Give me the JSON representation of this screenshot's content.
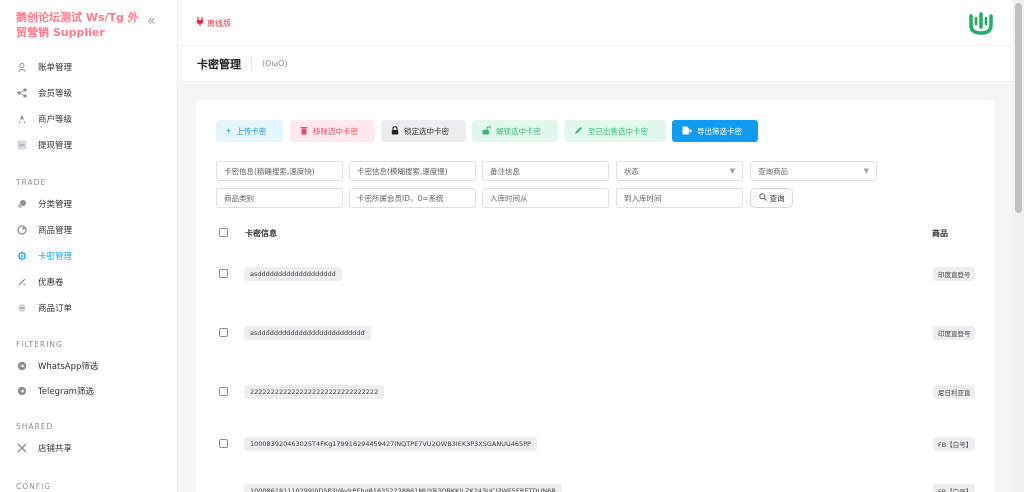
{
  "brand": {
    "name": "鹅创论坛测试 Ws/Tg 外贸营销 Supplier",
    "collapse_icon": "double-chevron-left-icon"
  },
  "sidebar": {
    "top_items": [
      {
        "label": "账单管理",
        "icon": "user-bill-icon"
      },
      {
        "label": "会员等级",
        "icon": "share-nodes-icon"
      },
      {
        "label": "商户等级",
        "icon": "rocket-icon"
      },
      {
        "label": "提现管理",
        "icon": "minus-box-icon"
      }
    ],
    "trade_title": "TRADE",
    "trade_items": [
      {
        "label": "分类管理",
        "icon": "category-icon"
      },
      {
        "label": "商品管理",
        "icon": "goods-icon"
      },
      {
        "label": "卡密管理",
        "icon": "gear-icon",
        "active": true
      },
      {
        "label": "优惠卷",
        "icon": "coupon-icon"
      },
      {
        "label": "商品订单",
        "icon": "order-icon"
      }
    ],
    "filtering_title": "FILTERING",
    "filtering_items": [
      {
        "label": "WhatsApp筛选",
        "icon": "arrow-circle-icon"
      },
      {
        "label": "Telegram筛选",
        "icon": "arrow-circle-icon"
      }
    ],
    "shared_title": "SHARED",
    "shared_items": [
      {
        "label": "店铺共享",
        "icon": "tools-icon"
      }
    ],
    "next_title": "CONFIG"
  },
  "header": {
    "offline_label": "离线版",
    "accent": "#1aa3e8"
  },
  "page": {
    "title": "卡密管理",
    "emote": "(OωO)"
  },
  "toolbar": {
    "upload": "上传卡密",
    "remove": "移除选中卡密",
    "lock": "锁定选中卡密",
    "unlock": "解锁选中卡密",
    "sold": "至已出售选中卡密",
    "export": "导出筛选卡密"
  },
  "filters": {
    "card_exact": "卡密信息(精确搜索,速度快)",
    "card_fuzzy": "卡密信息(模糊搜索,速度慢)",
    "remark": "备注信息",
    "status": "状态",
    "goods": "查询商品",
    "category": "商品类别",
    "member_id": "卡密所属会员ID，0=系统",
    "time_from": "入库时间从",
    "time_to": "到入库时间",
    "search": "查询"
  },
  "table": {
    "col_card": "卡密信息",
    "col_goods": "商品",
    "rows": [
      {
        "card": "asddddddddddddddddddd",
        "goods": "印度直登号"
      },
      {
        "card": "asdddddddddddddddddddddddddd",
        "goods": "印度直登号"
      },
      {
        "card": "2222222222222222222222222222222",
        "goods": "尼日利亚直"
      },
      {
        "card": "100083920463025T4FKg179916294459427INQTPE7VU2OWB3IEK3P3XSGANUU465PP",
        "goods": "FB【白号】"
      },
      {
        "card": "100086181110299|0D5P3V6ylrPEhg818352238861MUYR3OBKKILZK243UCJ3WF5ERETDUN6R",
        "goods": "FB【白号】"
      }
    ]
  }
}
